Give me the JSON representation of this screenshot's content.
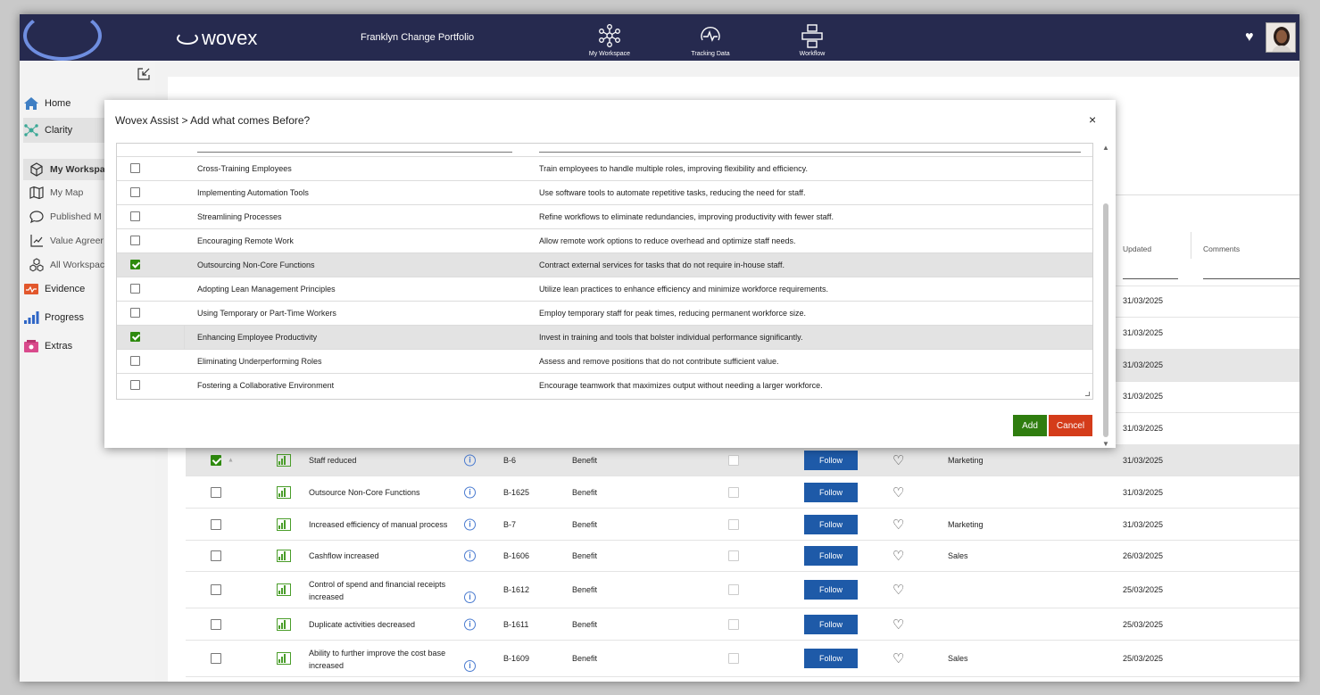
{
  "header": {
    "brand": "wovex",
    "portfolio": "Franklyn Change Portfolio",
    "nav": [
      {
        "label": "My Workspace",
        "icon": "network-icon"
      },
      {
        "label": "Tracking Data",
        "icon": "tracking-icon"
      },
      {
        "label": "Workflow",
        "icon": "workflow-icon"
      }
    ]
  },
  "sidebar": {
    "items": [
      {
        "label": "Home",
        "icon": "home-icon"
      },
      {
        "label": "Clarity",
        "icon": "clarity-icon"
      },
      {
        "label": "My Workspac",
        "icon": "cube-icon"
      },
      {
        "label": "My Map",
        "icon": "map-icon"
      },
      {
        "label": "Published M",
        "icon": "chat-icon"
      },
      {
        "label": "Value Agreer",
        "icon": "chart-icon"
      },
      {
        "label": "All Workspac",
        "icon": "cubes-icon"
      },
      {
        "label": "Evidence",
        "icon": "evidence-icon"
      },
      {
        "label": "Progress",
        "icon": "progress-icon"
      },
      {
        "label": "Extras",
        "icon": "extras-icon"
      }
    ]
  },
  "main": {
    "columns": {
      "updated": "Updated",
      "comments": "Comments"
    },
    "top_dates": [
      "31/03/2025",
      "31/03/2025",
      "31/03/2025",
      "31/03/2025",
      "31/03/2025"
    ],
    "rows": [
      {
        "checked": true,
        "name": "Staff reduced",
        "name2": "",
        "id": "B-6",
        "type": "Benefit",
        "follow": "Follow",
        "dept": "Marketing",
        "date": "31/03/2025"
      },
      {
        "checked": false,
        "name": "Outsource Non-Core Functions",
        "name2": "",
        "id": "B-1625",
        "type": "Benefit",
        "follow": "Follow",
        "dept": "",
        "date": "31/03/2025"
      },
      {
        "checked": false,
        "name": "Increased efficiency of manual process",
        "name2": "",
        "id": "B-7",
        "type": "Benefit",
        "follow": "Follow",
        "dept": "Marketing",
        "date": "31/03/2025"
      },
      {
        "checked": false,
        "name": "Cashflow increased",
        "name2": "",
        "id": "B-1606",
        "type": "Benefit",
        "follow": "Follow",
        "dept": "Sales",
        "date": "26/03/2025"
      },
      {
        "checked": false,
        "name": "Control of spend and financial receipts",
        "name2": "increased",
        "id": "B-1612",
        "type": "Benefit",
        "follow": "Follow",
        "dept": "",
        "date": "25/03/2025"
      },
      {
        "checked": false,
        "name": "Duplicate activities decreased",
        "name2": "",
        "id": "B-1611",
        "type": "Benefit",
        "follow": "Follow",
        "dept": "",
        "date": "25/03/2025"
      },
      {
        "checked": false,
        "name": "Ability to further improve the cost base",
        "name2": "increased",
        "id": "B-1609",
        "type": "Benefit",
        "follow": "Follow",
        "dept": "Sales",
        "date": "25/03/2025"
      }
    ]
  },
  "dialog": {
    "title": "Wovex Assist > Add what comes Before?",
    "close": "×",
    "add": "Add",
    "cancel": "Cancel",
    "rows": [
      {
        "checked": false,
        "name": "Cross-Training Employees",
        "desc": "Train employees to handle multiple roles, improving flexibility and efficiency."
      },
      {
        "checked": false,
        "name": "Implementing Automation Tools",
        "desc": "Use software tools to automate repetitive tasks, reducing the need for staff."
      },
      {
        "checked": false,
        "name": "Streamlining Processes",
        "desc": "Refine workflows to eliminate redundancies, improving productivity with fewer staff."
      },
      {
        "checked": false,
        "name": "Encouraging Remote Work",
        "desc": "Allow remote work options to reduce overhead and optimize staff needs."
      },
      {
        "checked": true,
        "name": "Outsourcing Non-Core Functions",
        "desc": "Contract external services for tasks that do not require in-house staff."
      },
      {
        "checked": false,
        "name": "Adopting Lean Management Principles",
        "desc": "Utilize lean practices to enhance efficiency and minimize workforce requirements."
      },
      {
        "checked": false,
        "name": "Using Temporary or Part-Time Workers",
        "desc": "Employ temporary staff for peak times, reducing permanent workforce size."
      },
      {
        "checked": true,
        "name": "Enhancing Employee Productivity",
        "desc": "Invest in training and tools that bolster individual performance significantly."
      },
      {
        "checked": false,
        "name": "Eliminating Underperforming Roles",
        "desc": "Assess and remove positions that do not contribute sufficient value."
      },
      {
        "checked": false,
        "name": "Fostering a Collaborative Environment",
        "desc": "Encourage teamwork that maximizes output without needing a larger workforce."
      }
    ]
  },
  "colors": {
    "topbar": "#262a4f",
    "follow": "#1e5aa8",
    "add": "#2f7d0f",
    "cancel": "#d43c1a",
    "check": "#2e8a0e"
  }
}
